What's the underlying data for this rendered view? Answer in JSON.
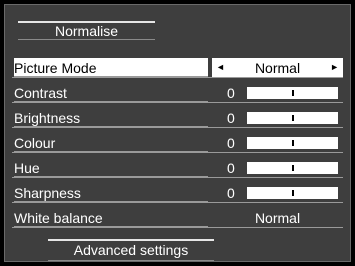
{
  "menu": {
    "normalise_label": "Normalise",
    "advanced_label": "Advanced settings",
    "picture_mode": {
      "label": "Picture Mode",
      "value": "Normal",
      "left_arrow": "◄",
      "right_arrow": "►"
    },
    "sliders": [
      {
        "label": "Contrast",
        "value": "0",
        "level": 0.5
      },
      {
        "label": "Brightness",
        "value": "0",
        "level": 0.5
      },
      {
        "label": "Colour",
        "value": "0",
        "level": 0.5
      },
      {
        "label": "Hue",
        "value": "0",
        "level": 0.5
      },
      {
        "label": "Sharpness",
        "value": "0",
        "level": 0.5
      }
    ],
    "white_balance": {
      "label": "White balance",
      "value": "Normal"
    }
  }
}
